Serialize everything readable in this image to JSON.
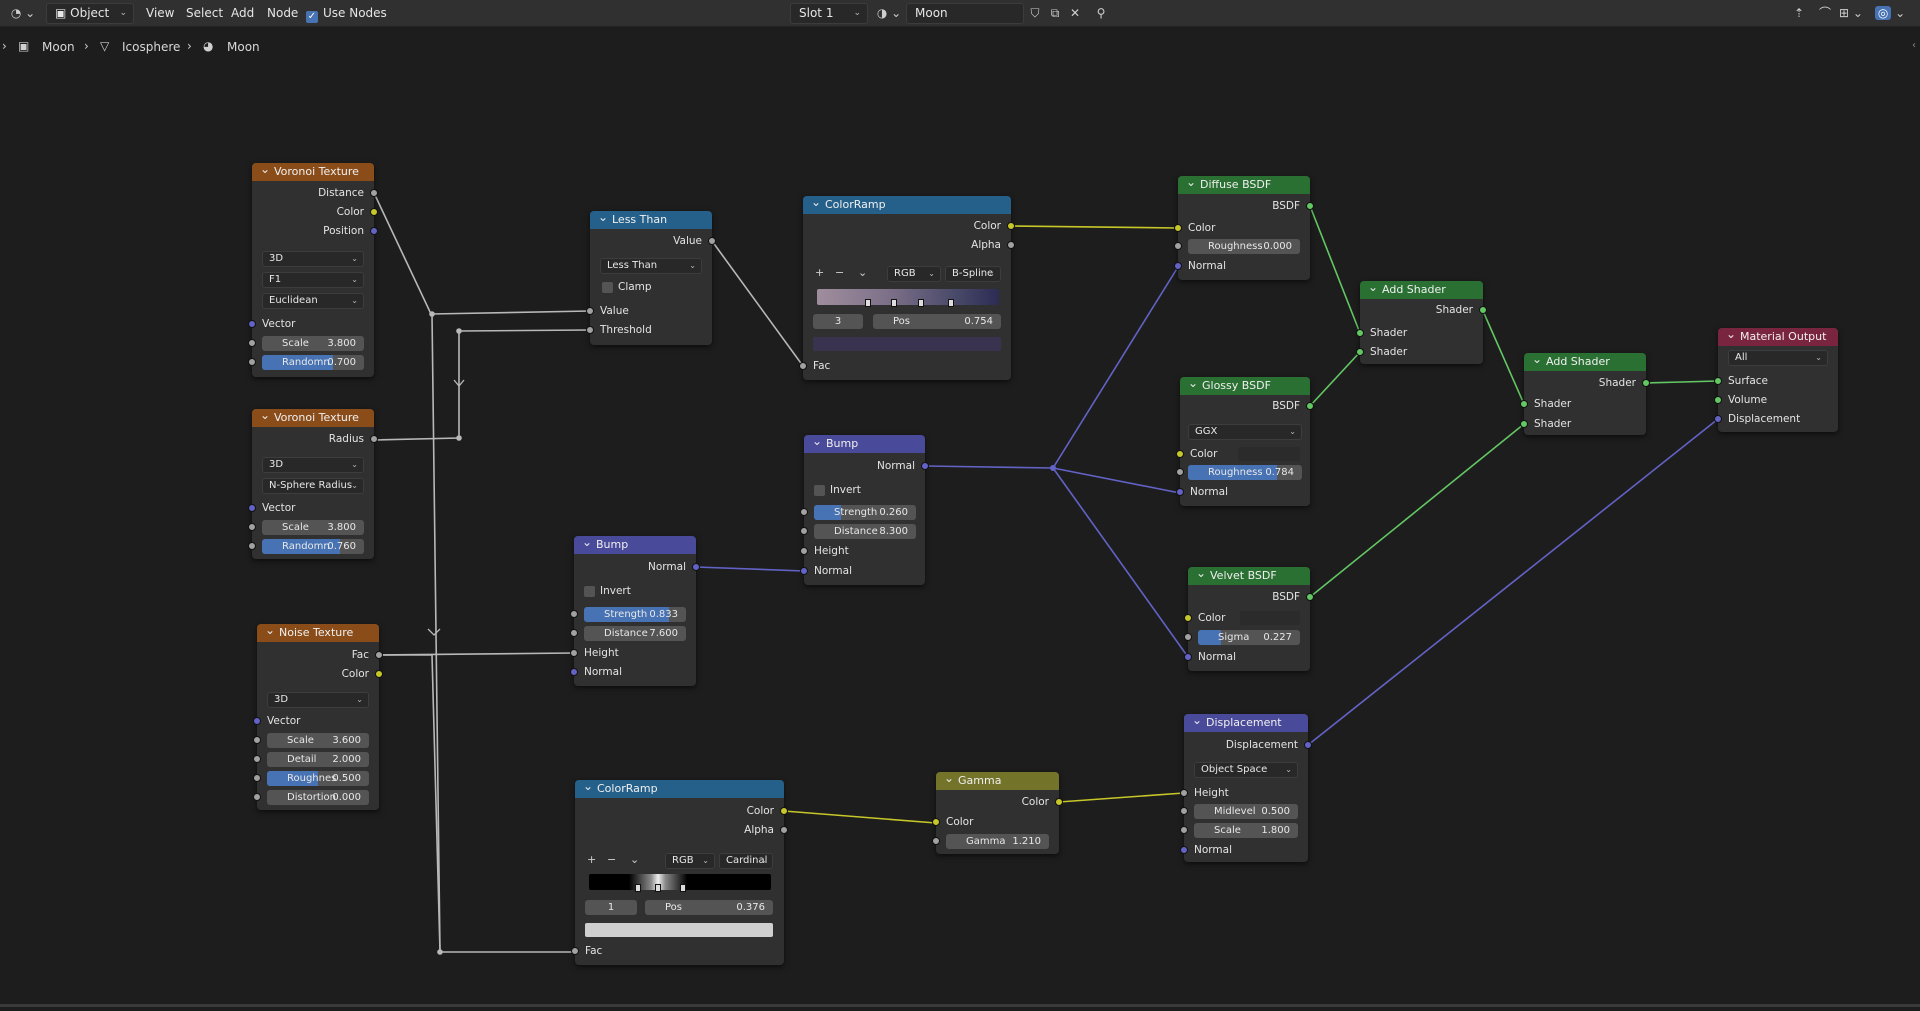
{
  "header": {
    "editor_type_icon": "node-editor-icon",
    "mode": "Object",
    "menus": [
      "View",
      "Select",
      "Add",
      "Node"
    ],
    "use_nodes_label": "Use Nodes",
    "slot": "Slot 1",
    "material_name": "Moon"
  },
  "breadcrumb": [
    "Moon",
    "Icosphere",
    "Moon"
  ],
  "nodes": {
    "voronoi1": {
      "title": "Voronoi Texture",
      "outputs": [
        "Distance",
        "Color",
        "Position"
      ],
      "dim": "3D",
      "feature": "F1",
      "metric": "Euclidean",
      "vector": "Vector",
      "scale_label": "Scale",
      "scale": "3.800",
      "rand_label": "Randomn",
      "rand": "0.700",
      "rand_frac": 0.7
    },
    "voronoi2": {
      "title": "Voronoi Texture",
      "output": "Radius",
      "dim": "3D",
      "feature": "N-Sphere Radius",
      "vector": "Vector",
      "scale_label": "Scale",
      "scale": "3.800",
      "rand_label": "Randomn",
      "rand": "0.760",
      "rand_frac": 0.76
    },
    "noise": {
      "title": "Noise Texture",
      "outputs": [
        "Fac",
        "Color"
      ],
      "dim": "3D",
      "vector": "Vector",
      "scale_label": "Scale",
      "scale": "3.600",
      "detail_label": "Detail",
      "detail": "2.000",
      "rough_label": "Roughnes",
      "rough": "0.500",
      "rough_frac": 0.5,
      "dist_label": "Distortion",
      "dist": "0.000"
    },
    "lessthan": {
      "title": "Less Than",
      "output": "Value",
      "op": "Less Than",
      "clamp": "Clamp",
      "in1": "Value",
      "in2": "Threshold"
    },
    "colorramp1": {
      "title": "ColorRamp",
      "outputs": [
        "Color",
        "Alpha"
      ],
      "mode": "RGB",
      "interp": "B-Spline",
      "index": "3",
      "pos_label": "Pos",
      "pos": "0.754",
      "input": "Fac"
    },
    "bump1": {
      "title": "Bump",
      "output": "Normal",
      "invert": "Invert",
      "strength_label": "Strength",
      "strength": "0.833",
      "strength_frac": 0.833,
      "distance_label": "Distance",
      "distance": "7.600",
      "in_height": "Height",
      "in_normal": "Normal"
    },
    "bump2": {
      "title": "Bump",
      "output": "Normal",
      "invert": "Invert",
      "strength_label": "Strength",
      "strength": "0.260",
      "strength_frac": 0.26,
      "distance_label": "Distance",
      "distance": "8.300",
      "in_height": "Height",
      "in_normal": "Normal"
    },
    "colorramp2": {
      "title": "ColorRamp",
      "outputs": [
        "Color",
        "Alpha"
      ],
      "mode": "RGB",
      "interp": "Cardinal",
      "index": "1",
      "pos_label": "Pos",
      "pos": "0.376",
      "input": "Fac"
    },
    "gamma": {
      "title": "Gamma",
      "output": "Color",
      "in": "Color",
      "gamma_label": "Gamma",
      "gamma": "1.210"
    },
    "diffuse": {
      "title": "Diffuse BSDF",
      "output": "BSDF",
      "color": "Color",
      "rough_label": "Roughness",
      "rough": "0.000",
      "normal": "Normal"
    },
    "glossy": {
      "title": "Glossy BSDF",
      "output": "BSDF",
      "dist": "GGX",
      "color": "Color",
      "rough_label": "Roughness",
      "rough": "0.784",
      "rough_frac": 0.784,
      "normal": "Normal"
    },
    "velvet": {
      "title": "Velvet BSDF",
      "output": "BSDF",
      "color": "Color",
      "sigma_label": "Sigma",
      "sigma": "0.227",
      "sigma_frac": 0.227,
      "normal": "Normal"
    },
    "displacement": {
      "title": "Displacement",
      "output": "Displacement",
      "space": "Object Space",
      "height": "Height",
      "mid_label": "Midlevel",
      "mid": "0.500",
      "scale_label": "Scale",
      "scale": "1.800",
      "normal": "Normal"
    },
    "add1": {
      "title": "Add Shader",
      "output": "Shader",
      "in1": "Shader",
      "in2": "Shader"
    },
    "add2": {
      "title": "Add Shader",
      "output": "Shader",
      "in1": "Shader",
      "in2": "Shader"
    },
    "matout": {
      "title": "Material Output",
      "target": "All",
      "in1": "Surface",
      "in2": "Volume",
      "in3": "Displacement"
    }
  },
  "colors": {
    "texture_header": "#8a4d1a",
    "converter_header": "#25608a",
    "vector_header": "#4a4a9a",
    "shader_header": "#2a7033",
    "color_header": "#73732a",
    "output_header": "#7a2540",
    "accent": "#4772b3"
  }
}
